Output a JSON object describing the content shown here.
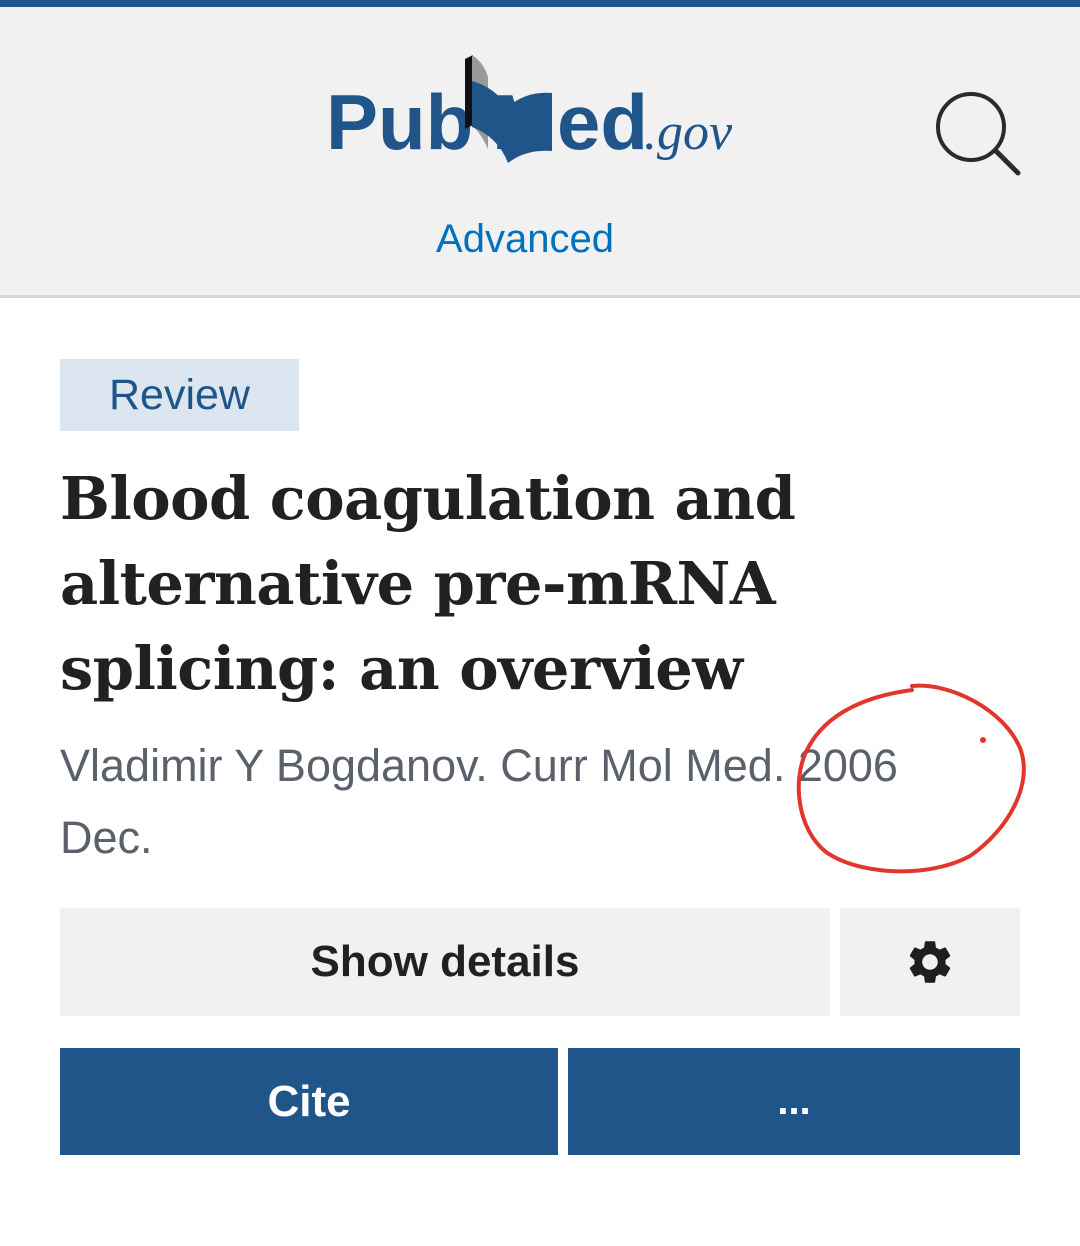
{
  "header": {
    "logo_pub": "Pub",
    "logo_med": "Med",
    "logo_gov": ".gov",
    "advanced_label": "Advanced",
    "search_icon": "search-icon",
    "brand_color": "#20558a",
    "link_color": "#0071bc"
  },
  "article": {
    "badge": "Review",
    "title_line1": "Blood coagulation and",
    "title_line2": "alternative pre-mRNA",
    "title_line3": "splicing: an overview",
    "citation_line1": "Vladimir Y Bogdanov. Curr Mol Med. 2006",
    "citation_line2": "Dec."
  },
  "actions": {
    "show_details_label": "Show details",
    "settings_icon": "gear-icon",
    "cite_label": "Cite",
    "more_label": "...",
    "primary_color": "#20558a"
  },
  "annotation": {
    "color": "#e0362c"
  }
}
